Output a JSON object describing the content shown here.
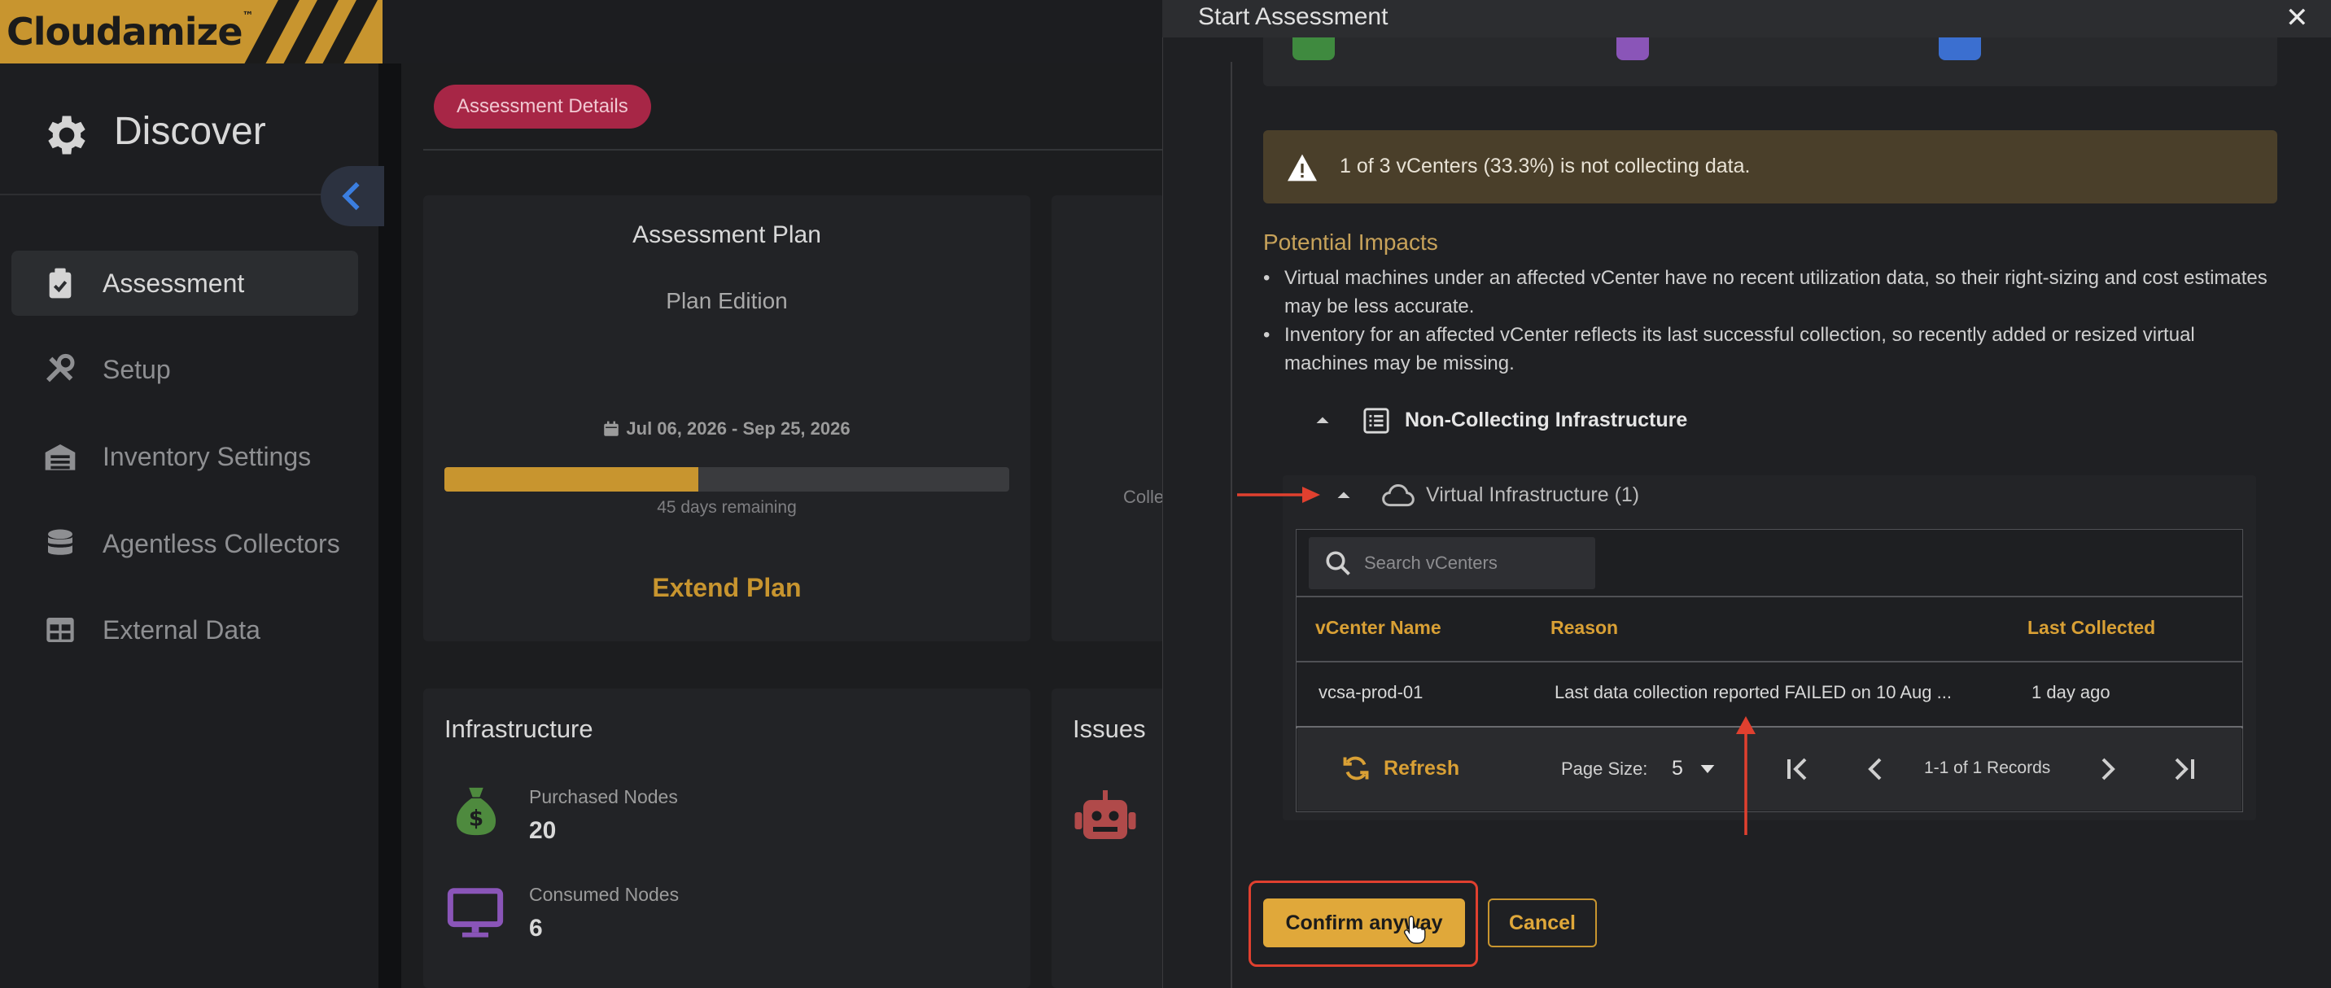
{
  "app": {
    "logo_text": "Cloudamize",
    "logo_mark": "™"
  },
  "sidebar": {
    "section_title": "Discover",
    "section_icon": "gear-icon",
    "items": [
      {
        "label": "Assessment",
        "icon": "clipboard-check-icon",
        "active": true
      },
      {
        "label": "Setup",
        "icon": "tools-icon",
        "active": false
      },
      {
        "label": "Inventory Settings",
        "icon": "warehouse-icon",
        "active": false
      },
      {
        "label": "Agentless Collectors",
        "icon": "database-icon",
        "active": false
      },
      {
        "label": "External Data",
        "icon": "table-icon",
        "active": false
      }
    ]
  },
  "main": {
    "tab_label": "Assessment Details",
    "plan": {
      "title": "Assessment Plan",
      "edition": "Plan Edition",
      "dates": "Jul 06, 2026 - Sep 25, 2026",
      "progress_fraction": 0.45,
      "remaining": "45 days remaining",
      "extend_label": "Extend Plan"
    },
    "collec_partial": "Colle",
    "infrastructure": {
      "title": "Infrastructure",
      "metrics": [
        {
          "label": "Purchased Nodes",
          "value": "20",
          "icon": "money-bag-icon"
        },
        {
          "label": "Consumed Nodes",
          "value": "6",
          "icon": "monitor-icon"
        }
      ]
    },
    "issues": {
      "title": "Issues",
      "icon": "robot-icon"
    }
  },
  "modal": {
    "title": "Start Assessment",
    "close_glyph": "✕",
    "warning": "1 of 3 vCenters (33.3%) is not collecting data.",
    "impacts_title": "Potential Impacts",
    "impacts": [
      "Virtual machines under an affected vCenter have no recent utilization data, so their right-sizing and cost estimates may be less accurate.",
      "Inventory for an affected vCenter reflects its last successful collection, so recently added or resized virtual machines may be missing."
    ],
    "non_collecting_label": "Non-Collecting Infrastructure",
    "virtual_infra_label": "Virtual Infrastructure (1)",
    "search_placeholder": "Search vCenters",
    "table": {
      "columns": [
        "vCenter Name",
        "Reason",
        "Last Collected"
      ],
      "rows": [
        [
          "vcsa-prod-01",
          "Last data collection reported FAILED on 10 Aug ...",
          "1 day ago"
        ]
      ]
    },
    "footer": {
      "refresh_label": "Refresh",
      "page_size_label": "Page Size:",
      "page_size_value": "5",
      "records_label": "1-1 of 1 Records"
    },
    "confirm_label": "Confirm anyway",
    "cancel_label": "Cancel",
    "colors": {
      "accent": "#c8952f",
      "warning_bg": "#4a3f2a",
      "highlight": "#e0402f",
      "pill": "#a72646"
    }
  }
}
